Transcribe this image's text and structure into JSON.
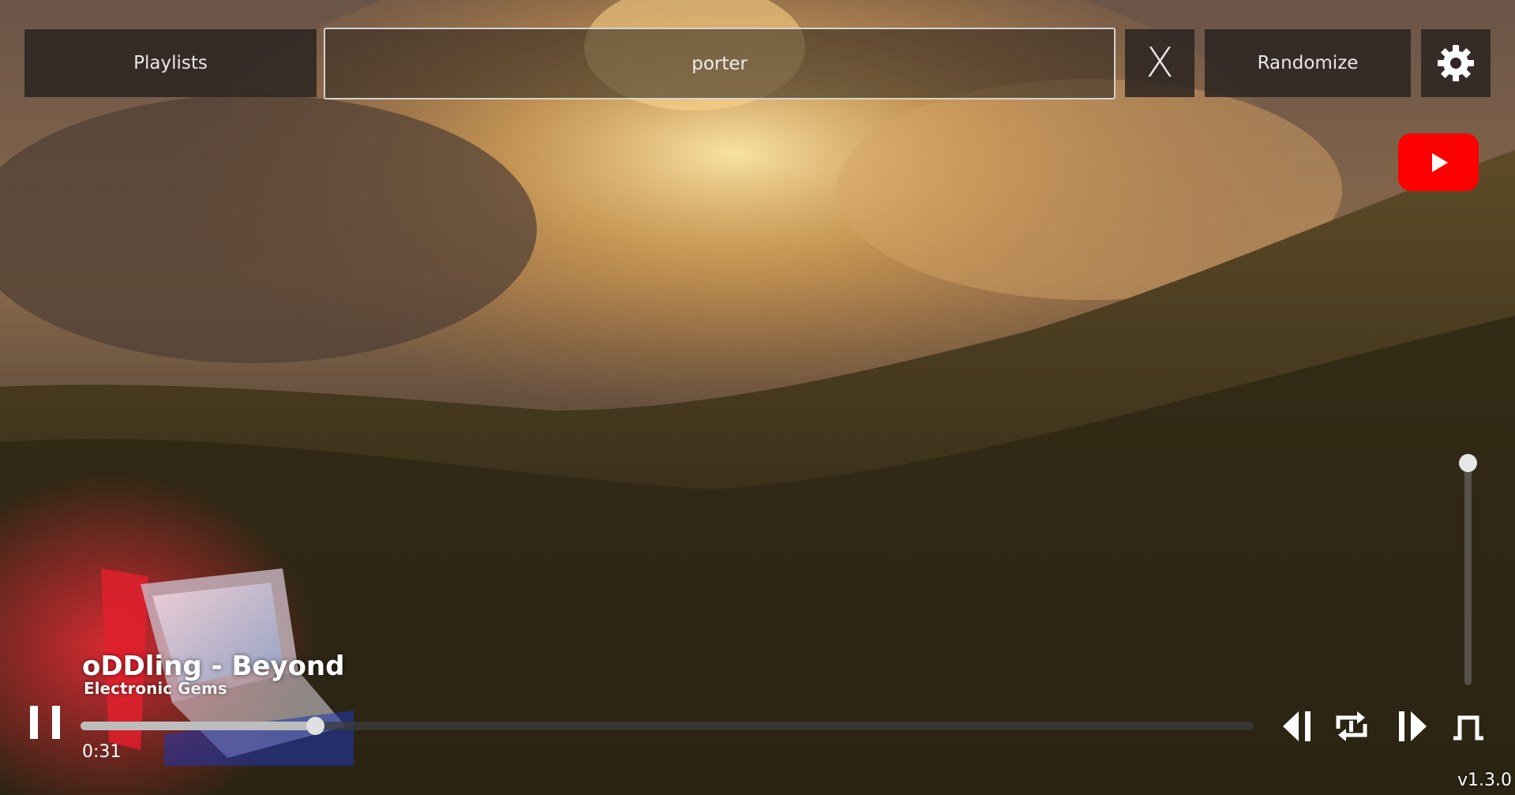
{
  "toolbar": {
    "playlists_label": "Playlists",
    "search_value": "porter",
    "clear_label": "X",
    "randomize_label": "Randomize"
  },
  "player": {
    "track_title": "oDDling - Beyond",
    "playlist_name": "Electronic Gems",
    "elapsed": "0:31",
    "progress_fraction": 0.2,
    "volume_fraction": 1.0
  },
  "version": "v1.3.0",
  "icons": {
    "settings": "gear-icon",
    "youtube": "youtube-icon",
    "pause": "pause-icon",
    "previous": "skip-previous-icon",
    "repeat": "repeat-icon",
    "next": "skip-next-icon",
    "shuffle": "shuffle-icon"
  },
  "colors": {
    "youtube_red": "#ff0000",
    "toolbar_bg": "#2d2622",
    "progress_fill": "#bdbdbd"
  }
}
